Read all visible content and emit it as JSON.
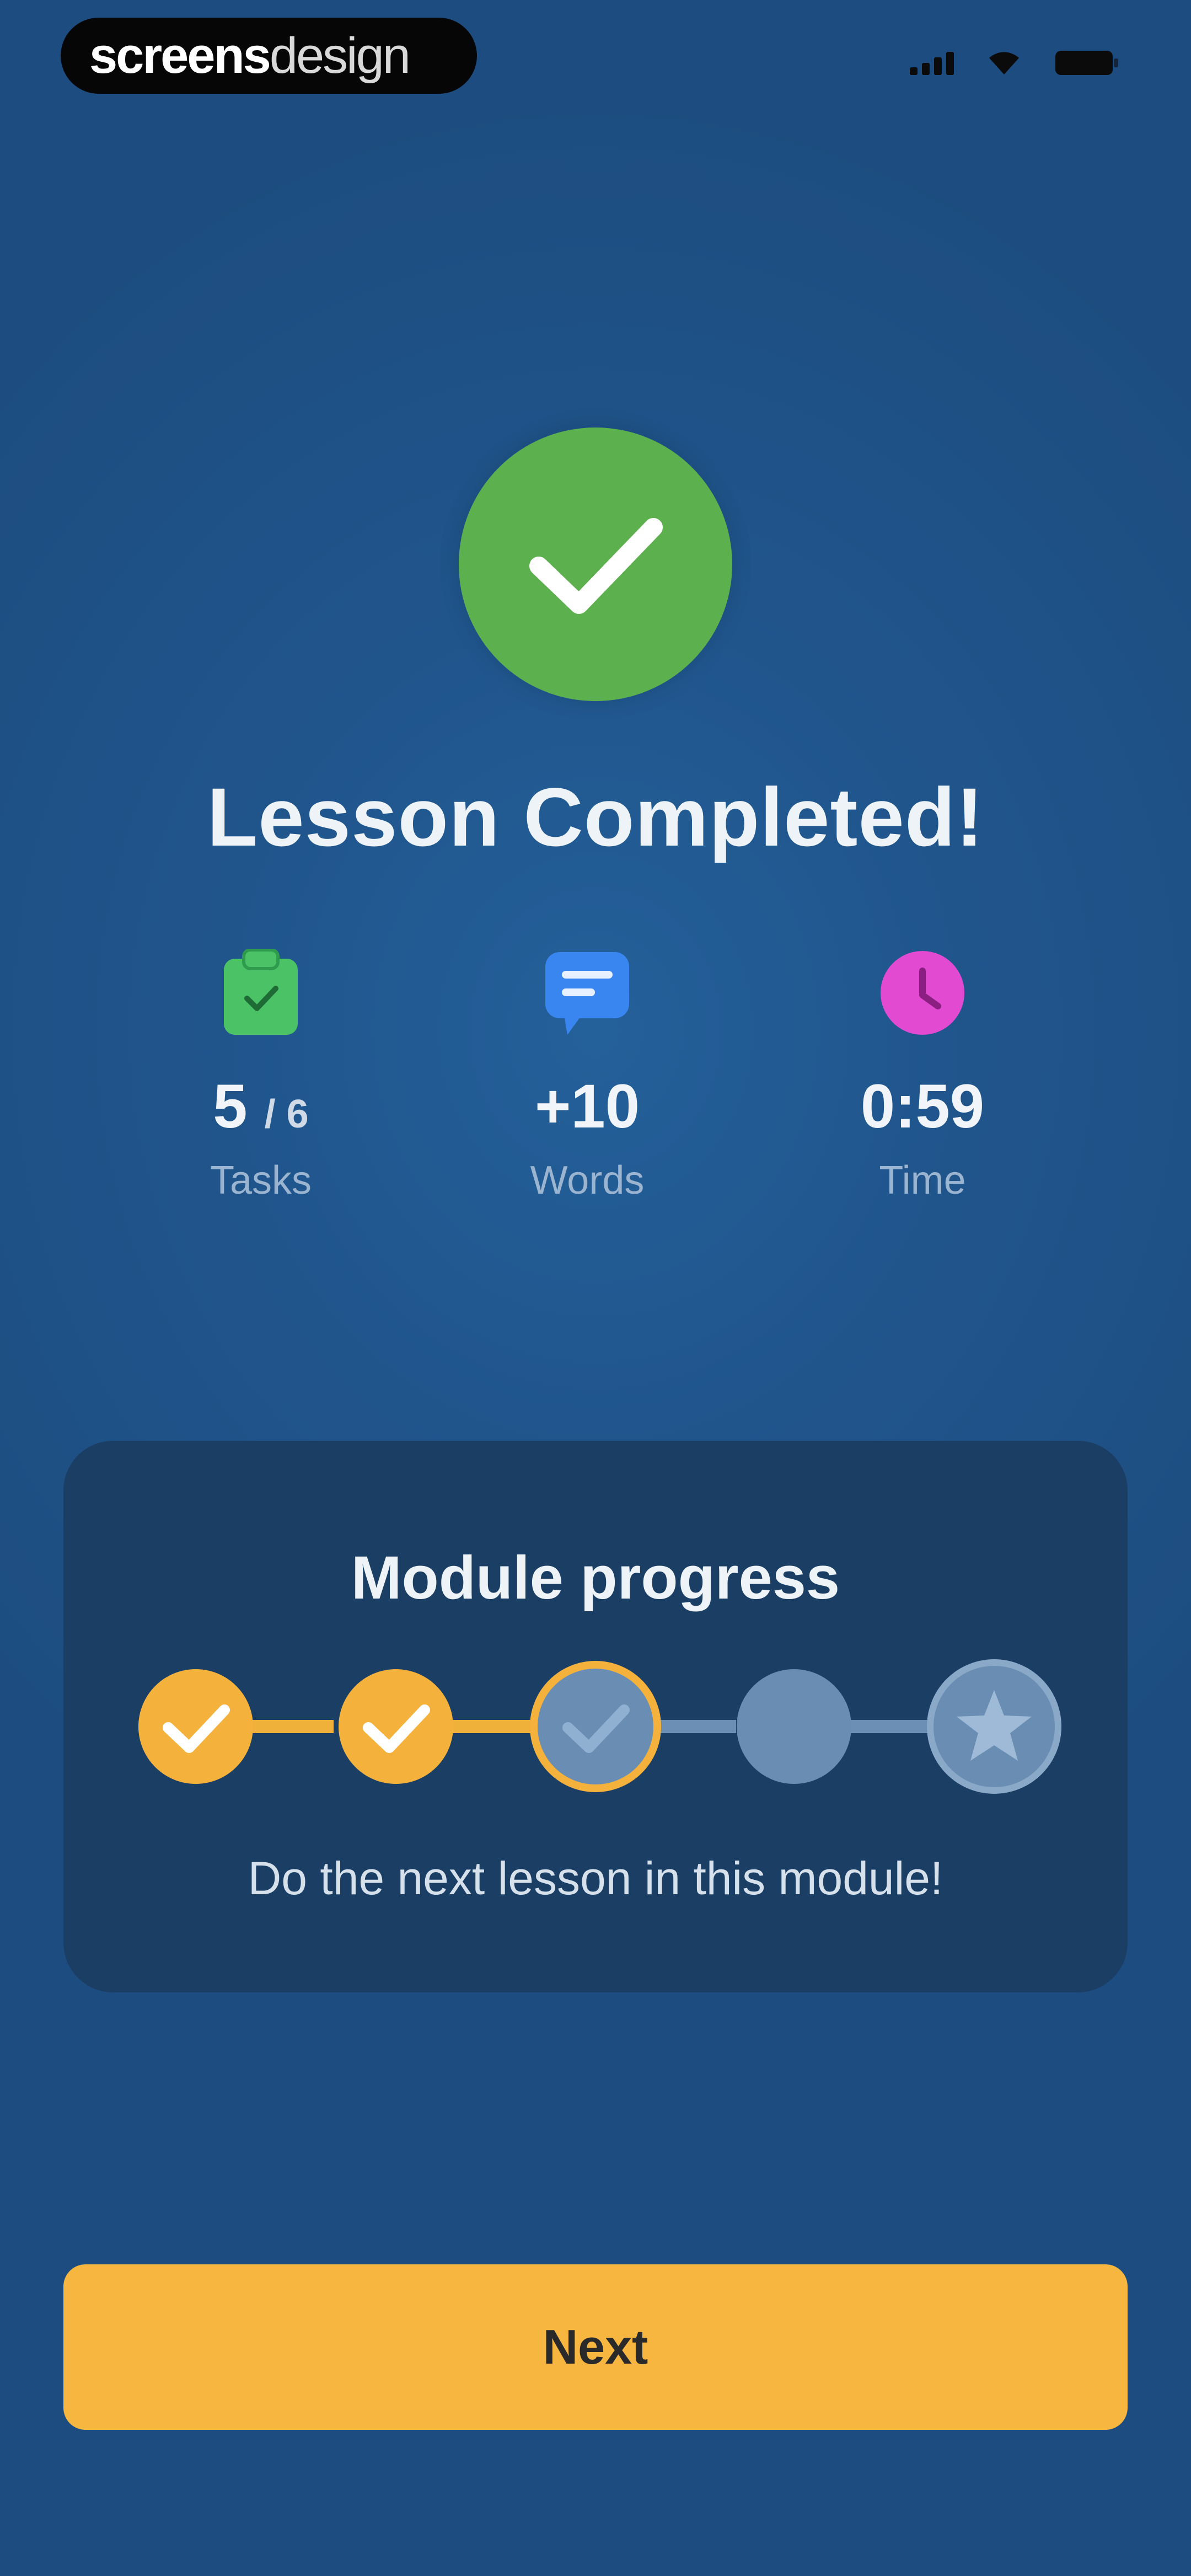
{
  "status_bar": {
    "brand_bold": "screens",
    "brand_light": "design"
  },
  "hero": {
    "icon": "check-icon",
    "title": "Lesson Completed!"
  },
  "stats": [
    {
      "icon": "clipboard-check-icon",
      "value": "5",
      "value_suffix": "/ 6",
      "label": "Tasks"
    },
    {
      "icon": "chat-bubble-icon",
      "value": "+10",
      "value_suffix": "",
      "label": "Words"
    },
    {
      "icon": "clock-icon",
      "value": "0:59",
      "value_suffix": "",
      "label": "Time"
    }
  ],
  "module_progress": {
    "title": "Module progress",
    "steps_completed": 2,
    "current_step": 3,
    "total_steps": 5,
    "final_step_icon": "star-icon",
    "hint": "Do the next lesson in this module!"
  },
  "actions": {
    "next_label": "Next"
  },
  "colors": {
    "background": "#20558c",
    "success_green": "#5db04e",
    "accent_yellow": "#f6b63f",
    "card_background": "#1b3e65",
    "tasks_icon_green": "#4cc267",
    "words_icon_blue": "#3a86f0",
    "time_icon_magenta": "#e24ad2"
  }
}
